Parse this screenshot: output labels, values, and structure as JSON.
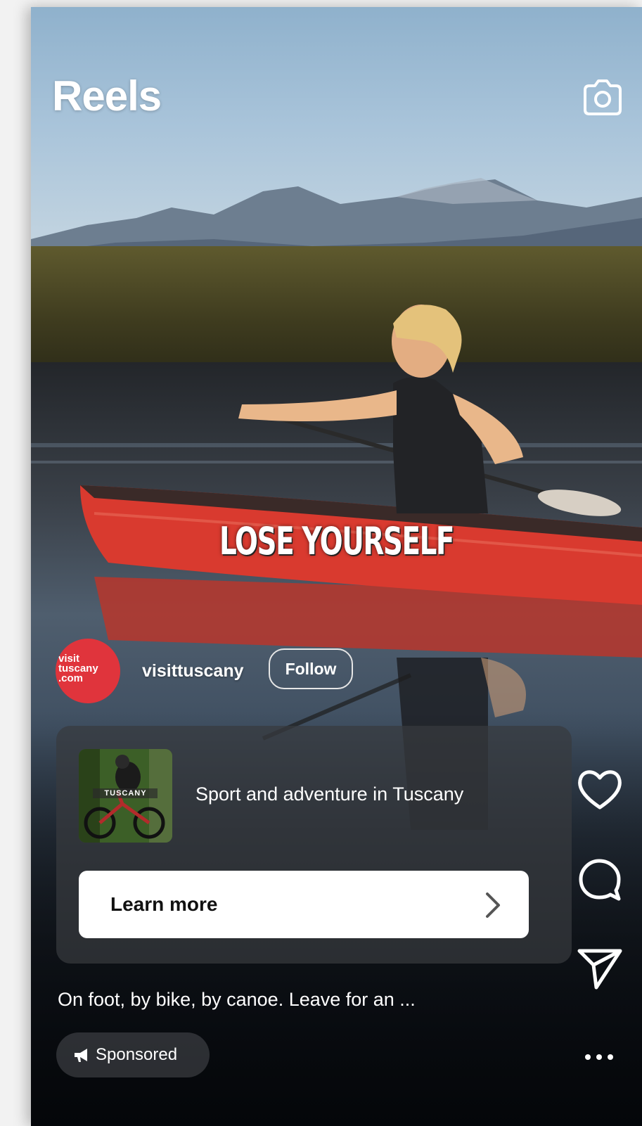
{
  "header": {
    "title": "Reels",
    "camera_icon": "camera-icon"
  },
  "reel": {
    "overlay_text": "LOSE YOURSELF",
    "account": {
      "avatar_text": "visit tuscany .com",
      "username": "visittuscany",
      "follow_label": "Follow"
    },
    "ad_card": {
      "thumbnail_text": "TUSCANY",
      "headline": "Sport and adventure in Tuscany",
      "cta_label": "Learn more",
      "cta_icon": "chevron-right-icon"
    },
    "caption": "On foot, by bike, by canoe. Leave for an ...",
    "sponsored_label": "Sponsored",
    "sponsored_icon": "megaphone-icon"
  },
  "actions": {
    "like_icon": "heart-icon",
    "comment_icon": "comment-icon",
    "share_icon": "send-icon",
    "more_icon": "more-horizontal-icon"
  },
  "colors": {
    "brand": "#e0343c",
    "canoe": "#d93a2f",
    "text": "#ffffff"
  }
}
